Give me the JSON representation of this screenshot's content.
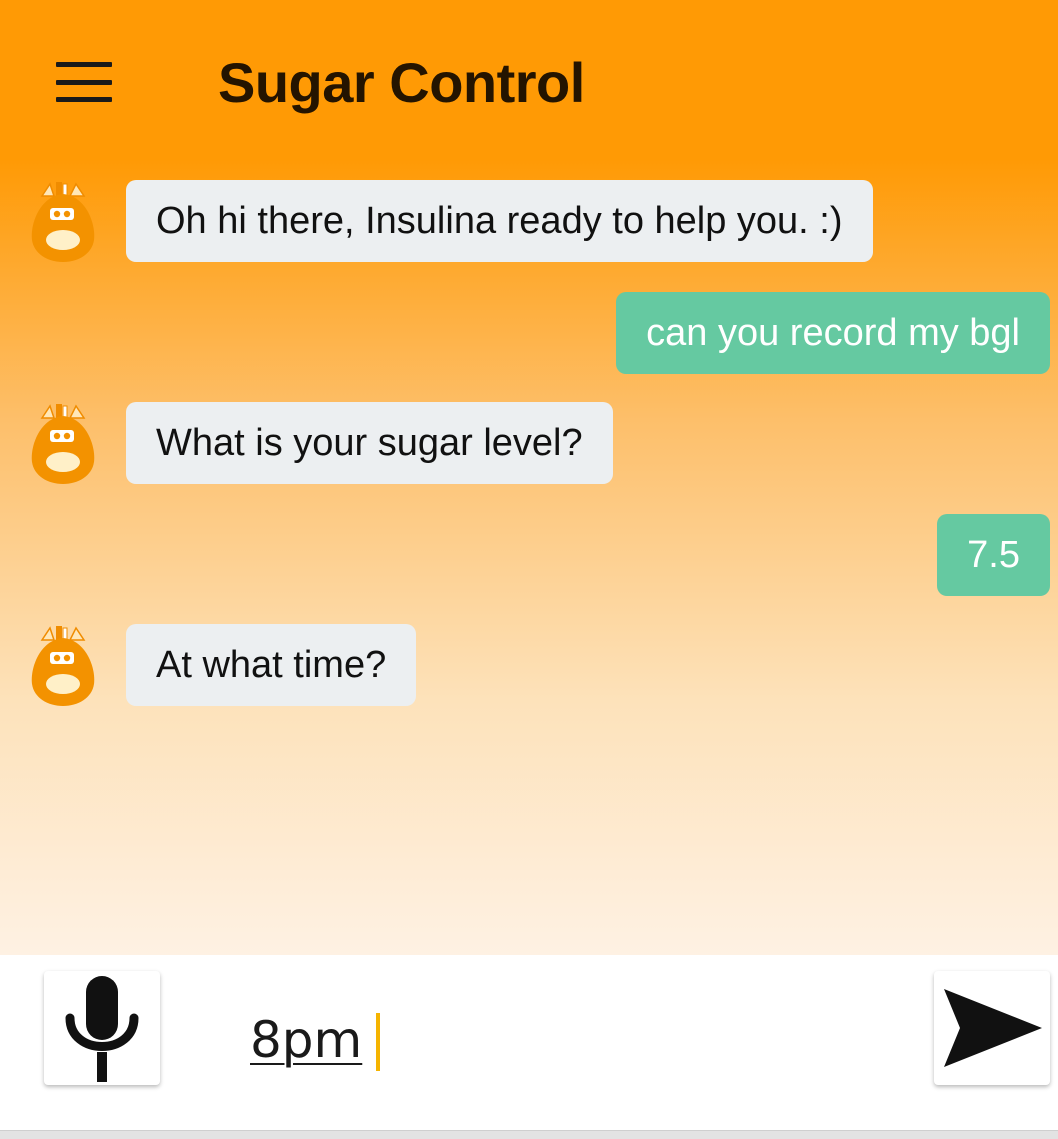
{
  "app": {
    "title": "Sugar Control",
    "menu_icon": "hamburger-menu-icon"
  },
  "colors": {
    "header_orange": "#ff9a05",
    "bot_bubble": "#eceff1",
    "user_bubble": "#65c9a1",
    "caret": "#f5b400"
  },
  "messages": [
    {
      "sender": "bot",
      "text": "Oh hi there, Insulina ready to help you. :)"
    },
    {
      "sender": "user",
      "text": "can you record my bgl"
    },
    {
      "sender": "bot",
      "text": "What is your sugar level?"
    },
    {
      "sender": "user",
      "text": "7.5"
    },
    {
      "sender": "bot",
      "text": "At what time?"
    }
  ],
  "composer": {
    "value": "8pm",
    "mic_icon": "microphone-icon",
    "send_icon": "send-arrow-icon"
  }
}
